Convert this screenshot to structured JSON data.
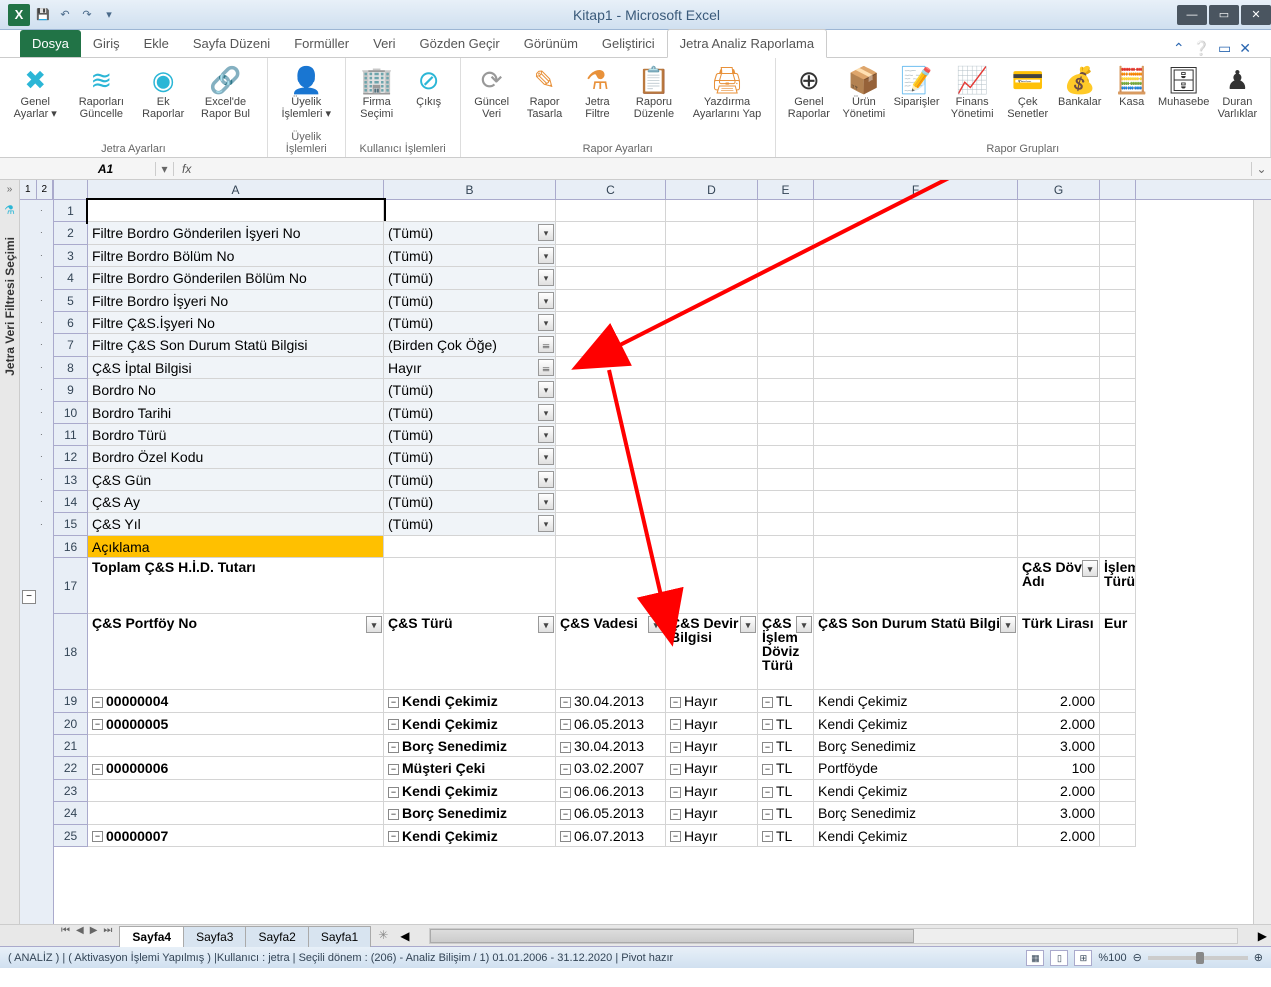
{
  "titlebar": {
    "title": "Kitap1 - Microsoft Excel",
    "excel_letter": "X"
  },
  "menu": {
    "file": "Dosya",
    "tabs": [
      "Giriş",
      "Ekle",
      "Sayfa Düzeni",
      "Formüller",
      "Veri",
      "Gözden Geçir",
      "Görünüm",
      "Geliştirici",
      "Jetra Analiz Raporlama"
    ]
  },
  "ribbon": {
    "groups": [
      {
        "label": "Jetra Ayarları",
        "buttons": [
          {
            "label": "Genel Ayarlar ▾",
            "icon": "✖",
            "cls": "cyan"
          },
          {
            "label": "Raporları Güncelle",
            "icon": "≋",
            "cls": "cyan"
          },
          {
            "label": "Ek Raporlar",
            "icon": "◉",
            "cls": "cyan"
          },
          {
            "label": "Excel'de Rapor Bul",
            "icon": "🔗",
            "cls": "cyan"
          }
        ]
      },
      {
        "label": "Üyelik İşlemleri",
        "buttons": [
          {
            "label": "Üyelik İşlemleri ▾",
            "icon": "👤",
            "cls": "cyan"
          }
        ]
      },
      {
        "label": "Kullanıcı İşlemleri",
        "buttons": [
          {
            "label": "Firma Seçimi",
            "icon": "🏢",
            "cls": "cyan"
          },
          {
            "label": "Çıkış",
            "icon": "⊘",
            "cls": "cyan"
          }
        ]
      },
      {
        "label": "Rapor Ayarları",
        "buttons": [
          {
            "label": "Güncel Veri",
            "icon": "⟳",
            "cls": "gray"
          },
          {
            "label": "Rapor Tasarla",
            "icon": "✎",
            "cls": "orange"
          },
          {
            "label": "Jetra Filtre",
            "icon": "⚗",
            "cls": "orange"
          },
          {
            "label": "Raporu Düzenle",
            "icon": "📋",
            "cls": "orange"
          },
          {
            "label": "Yazdırma Ayarlarını Yap",
            "icon": "🖨",
            "cls": "orange"
          }
        ]
      },
      {
        "label": "Rapor Grupları",
        "buttons": [
          {
            "label": "Genel Raporlar",
            "icon": "⊕",
            "cls": "dark"
          },
          {
            "label": "Ürün Yönetimi",
            "icon": "📦",
            "cls": "dark"
          },
          {
            "label": "Siparişler",
            "icon": "📝",
            "cls": "dark"
          },
          {
            "label": "Finans Yönetimi",
            "icon": "📈",
            "cls": "dark"
          },
          {
            "label": "Çek Senetler",
            "icon": "💳",
            "cls": "dark"
          },
          {
            "label": "Bankalar",
            "icon": "💰",
            "cls": "dark"
          },
          {
            "label": "Kasa",
            "icon": "🧮",
            "cls": "dark"
          },
          {
            "label": "Muhasebe",
            "icon": "🗄",
            "cls": "dark"
          },
          {
            "label": "Duran Varlıklar",
            "icon": "♟",
            "cls": "dark"
          }
        ]
      }
    ]
  },
  "namebox": "A1",
  "fx": "fx",
  "sidebar_label": "Jetra Veri Filtresi Seçimi",
  "filters": [
    {
      "row": 2,
      "label": "Filtre Bordro Gönderilen İşyeri No",
      "val": "(Tümü)",
      "btn": "▾"
    },
    {
      "row": 3,
      "label": "Filtre Bordro Bölüm No",
      "val": "(Tümü)",
      "btn": "▾"
    },
    {
      "row": 4,
      "label": "Filtre Bordro Gönderilen Bölüm No",
      "val": "(Tümü)",
      "btn": "▾"
    },
    {
      "row": 5,
      "label": "Filtre Bordro İşyeri No",
      "val": "(Tümü)",
      "btn": "▾"
    },
    {
      "row": 6,
      "label": "Filtre Ç&S.İşyeri No",
      "val": "(Tümü)",
      "btn": "▾"
    },
    {
      "row": 7,
      "label": "Filtre Ç&S Son Durum Statü Bilgisi",
      "val": "(Birden Çok Öğe)",
      "btn": "𝍢"
    },
    {
      "row": 8,
      "label": "Ç&S İptal Bilgisi",
      "val": "Hayır",
      "btn": "𝍢"
    },
    {
      "row": 9,
      "label": "Bordro No",
      "val": "(Tümü)",
      "btn": "▾"
    },
    {
      "row": 10,
      "label": "Bordro Tarihi",
      "val": "(Tümü)",
      "btn": "▾"
    },
    {
      "row": 11,
      "label": "Bordro Türü",
      "val": "(Tümü)",
      "btn": "▾"
    },
    {
      "row": 12,
      "label": "Bordro Özel Kodu",
      "val": "(Tümü)",
      "btn": "▾"
    },
    {
      "row": 13,
      "label": "Ç&S Gün",
      "val": "(Tümü)",
      "btn": "▾"
    },
    {
      "row": 14,
      "label": "Ç&S Ay",
      "val": "(Tümü)",
      "btn": "▾"
    },
    {
      "row": 15,
      "label": "Ç&S Yıl",
      "val": "(Tümü)",
      "btn": "▾"
    }
  ],
  "row16": "Açıklama",
  "row17a": "Toplam Ç&S H.İ.D. Tutarı",
  "row17g1": "Ç&S Döviz Adı",
  "row17g2": "İşlem Türü",
  "headers18": {
    "A": "Ç&S Portföy No",
    "B": "Ç&S Türü",
    "C": "Ç&S Vadesi",
    "D": "Ç&S Devir Bilgisi",
    "E": "Ç&S İşlem Döviz Türü",
    "F": "Ç&S Son Durum Statü Bilgisi",
    "G": "Türk Lirası",
    "H": "Eur"
  },
  "data_rows": [
    {
      "r": 19,
      "A": "00000004",
      "B": "Kendi Çekimiz",
      "C": "30.04.2013",
      "D": "Hayır",
      "E": "TL",
      "F": "Kendi Çekimiz",
      "G": "2.000",
      "exA": true,
      "ex": true
    },
    {
      "r": 20,
      "A": "00000005",
      "B": "Kendi Çekimiz",
      "C": "06.05.2013",
      "D": "Hayır",
      "E": "TL",
      "F": "Kendi Çekimiz",
      "G": "2.000",
      "exA": true,
      "ex": true
    },
    {
      "r": 21,
      "A": "",
      "B": "Borç Senedimiz",
      "C": "30.04.2013",
      "D": "Hayır",
      "E": "TL",
      "F": "Borç Senedimiz",
      "G": "3.000",
      "exA": false,
      "ex": true
    },
    {
      "r": 22,
      "A": "00000006",
      "B": "Müşteri Çeki",
      "C": "03.02.2007",
      "D": "Hayır",
      "E": "TL",
      "F": "Portföyde",
      "G": "100",
      "exA": true,
      "ex": true
    },
    {
      "r": 23,
      "A": "",
      "B": "Kendi Çekimiz",
      "C": "06.06.2013",
      "D": "Hayır",
      "E": "TL",
      "F": "Kendi Çekimiz",
      "G": "2.000",
      "exA": false,
      "ex": true
    },
    {
      "r": 24,
      "A": "",
      "B": "Borç Senedimiz",
      "C": "06.05.2013",
      "D": "Hayır",
      "E": "TL",
      "F": "Borç Senedimiz",
      "G": "3.000",
      "exA": false,
      "ex": true
    },
    {
      "r": 25,
      "A": "00000007",
      "B": "Kendi Çekimiz",
      "C": "06.07.2013",
      "D": "Hayır",
      "E": "TL",
      "F": "Kendi Çekimiz",
      "G": "2.000",
      "exA": true,
      "ex": true
    }
  ],
  "sheets": [
    "Sayfa4",
    "Sayfa3",
    "Sayfa2",
    "Sayfa1"
  ],
  "status": "( ANALİZ ) | ( Aktivasyon İşlemi Yapılmış ) |Kullanıcı : jetra | Seçili dönem : (206) - Analiz Bilişim / 1) 01.01.2006 - 31.12.2020  | Pivot hazır",
  "zoom": "%100",
  "cols": [
    "A",
    "B",
    "C",
    "D",
    "E",
    "F",
    "G"
  ]
}
